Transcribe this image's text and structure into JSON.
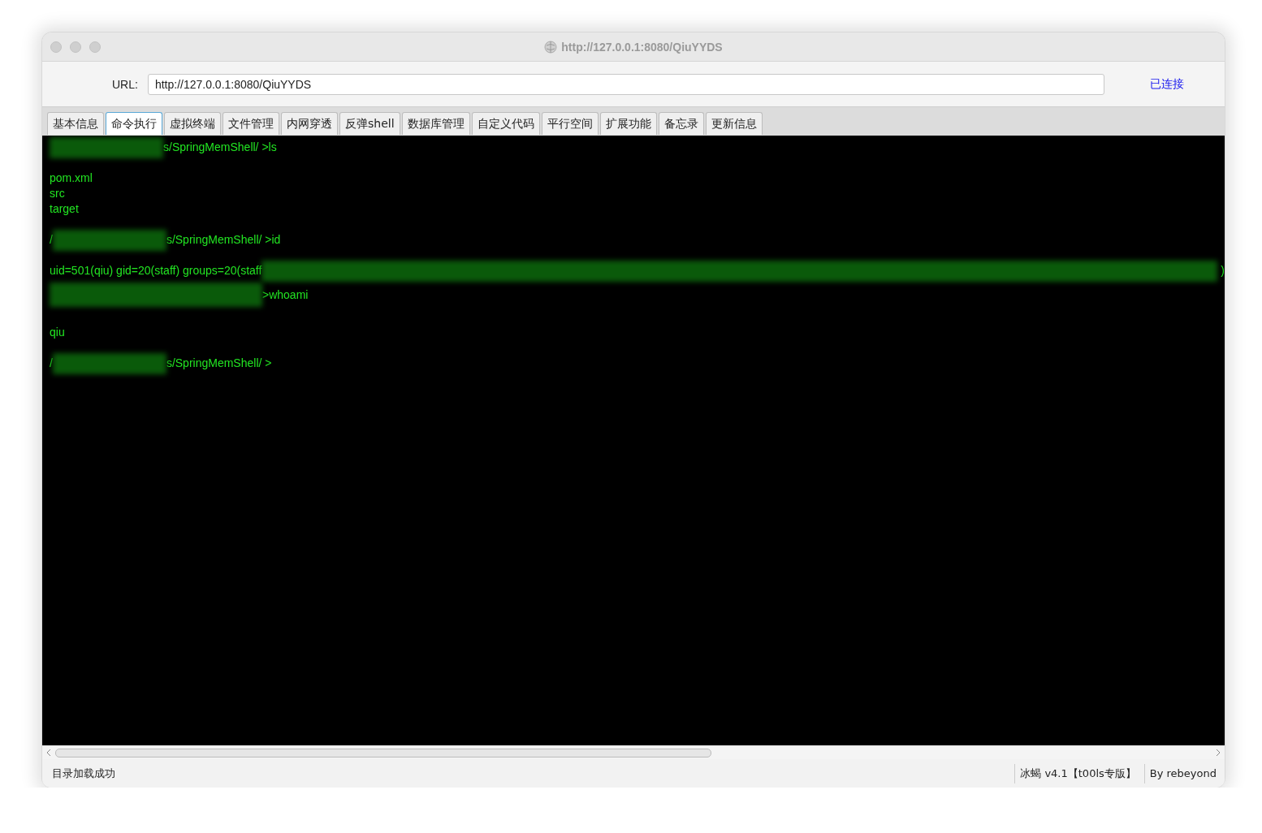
{
  "window": {
    "title": "http://127.0.0.1:8080/QiuYYDS"
  },
  "url_bar": {
    "label": "URL:",
    "value": "http://127.0.0.1:8080/QiuYYDS",
    "status": "已连接"
  },
  "tabs": [
    {
      "label": "基本信息",
      "selected": false
    },
    {
      "label": "命令执行",
      "selected": true
    },
    {
      "label": "虚拟终端",
      "selected": false
    },
    {
      "label": "文件管理",
      "selected": false
    },
    {
      "label": "内网穿透",
      "selected": false
    },
    {
      "label": "反弹shell",
      "selected": false
    },
    {
      "label": "数据库管理",
      "selected": false
    },
    {
      "label": "自定义代码",
      "selected": false
    },
    {
      "label": "平行空间",
      "selected": false
    },
    {
      "label": "扩展功能",
      "selected": false
    },
    {
      "label": "备忘录",
      "selected": false
    },
    {
      "label": "更新信息",
      "selected": false
    }
  ],
  "terminal": {
    "lines": [
      {
        "kind": "redacted",
        "text": "s/SpringMemShell/ >ls"
      },
      {
        "kind": "blank"
      },
      {
        "kind": "text",
        "text": "pom.xml"
      },
      {
        "kind": "text",
        "text": "src"
      },
      {
        "kind": "text",
        "text": "target"
      },
      {
        "kind": "blank"
      },
      {
        "kind": "redacted",
        "lead": "/",
        "text": "s/SpringMemShell/ >id"
      },
      {
        "kind": "blank"
      },
      {
        "kind": "tail_redacted",
        "text": "uid=501(qiu) gid=20(staff) groups=20(staff",
        "trail": ")"
      },
      {
        "kind": "redacted_wide",
        "text": ">whoami"
      },
      {
        "kind": "blank"
      },
      {
        "kind": "text",
        "text": "qiu"
      },
      {
        "kind": "blank"
      },
      {
        "kind": "redacted",
        "lead": "/",
        "text": "s/SpringMemShell/ >"
      }
    ]
  },
  "status_bar": {
    "message": "目录加载成功",
    "items": [
      "冰蝎 v4.1【t00ls专版】",
      "By rebeyond"
    ]
  }
}
